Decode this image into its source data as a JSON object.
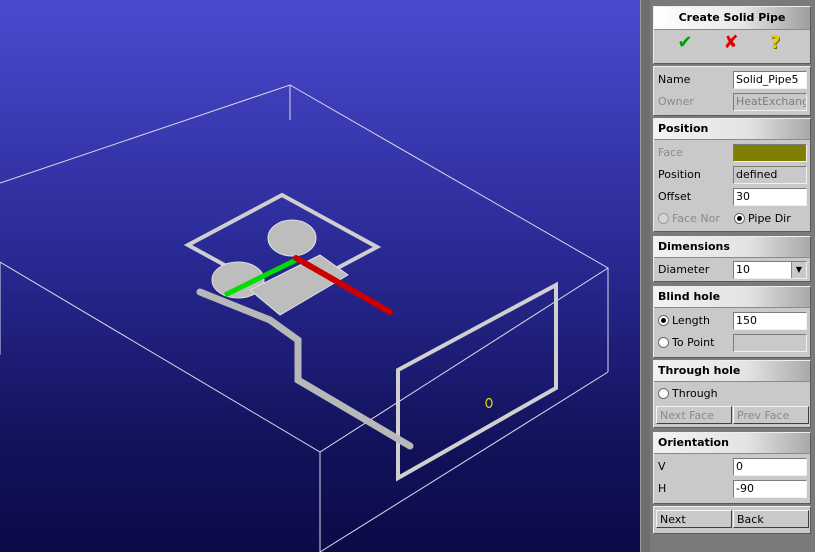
{
  "panel": {
    "title": "Create Solid Pipe",
    "actions": {
      "ok": "✔",
      "cancel": "✘",
      "help": "?"
    },
    "name": {
      "label": "Name",
      "value": "Solid_Pipe5"
    },
    "owner": {
      "label": "Owner",
      "value": "HeatExchange"
    },
    "position": {
      "header": "Position",
      "face_label": "Face",
      "face_color": "#808000",
      "position_label": "Position",
      "position_value": "defined",
      "offset_label": "Offset",
      "offset_value": "30",
      "radio_face_normal": "Face Nor",
      "radio_pipe_dir": "Pipe Dir",
      "selected": "Pipe Dir"
    },
    "dimensions": {
      "header": "Dimensions",
      "diameter_label": "Diameter",
      "diameter_value": "10"
    },
    "blind_hole": {
      "header": "Blind hole",
      "length_label": "Length",
      "length_value": "150",
      "to_point_label": "To Point",
      "to_point_value": "",
      "selected": "Length"
    },
    "through_hole": {
      "header": "Through hole",
      "through_label": "Through",
      "next_face": "Next Face",
      "prev_face": "Prev Face"
    },
    "orientation": {
      "header": "Orientation",
      "v_label": "V",
      "v_value": "0",
      "h_label": "H",
      "h_value": "-90"
    },
    "next": "Next",
    "back": "Back"
  },
  "colors": {
    "ok": "#00a000",
    "cancel": "#e00000",
    "help": "#e0d000",
    "axis_red": "#cc0000",
    "axis_green": "#00dd00"
  }
}
